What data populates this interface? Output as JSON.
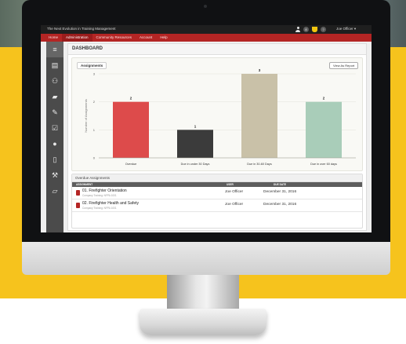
{
  "app": {
    "title": "The Next Evolution in Training Management",
    "user_menu": "Joe Officer ▾",
    "badge_1": "8",
    "badge_2": "?"
  },
  "nav": [
    "Home",
    "Administration",
    "Community Resources",
    "Account",
    "Help"
  ],
  "sidebar": [
    {
      "icon": "dashboard-icon",
      "glyph": "≡"
    },
    {
      "icon": "database-icon",
      "glyph": "▤"
    },
    {
      "icon": "users-icon",
      "glyph": "⚇"
    },
    {
      "icon": "book-icon",
      "glyph": "▰"
    },
    {
      "icon": "edit-icon",
      "glyph": "✎"
    },
    {
      "icon": "checkbox-icon",
      "glyph": "☑"
    },
    {
      "icon": "circle-icon",
      "glyph": "●"
    },
    {
      "icon": "document-icon",
      "glyph": "▯"
    },
    {
      "icon": "wrench-icon",
      "glyph": "⚒"
    },
    {
      "icon": "folder-icon",
      "glyph": "▱"
    }
  ],
  "page": {
    "title": "DASHBOARD"
  },
  "assignments": {
    "label": "Assignments",
    "report_button": "View As Report"
  },
  "chart_data": {
    "type": "bar",
    "categories": [
      "Overdue",
      "Due in under 30 Days",
      "Due in 30-60 Days",
      "Due in over 60 days"
    ],
    "values": [
      2,
      1,
      3,
      2
    ],
    "ylabel": "Number of Assignments",
    "ylim": [
      0,
      3
    ],
    "yticks": [
      0,
      1,
      2,
      3
    ],
    "colors": [
      "#dd4b4b",
      "#3b3b3b",
      "#c9c1a8",
      "#a9cdb9"
    ],
    "grid": true
  },
  "overdue": {
    "title": "Overdue Assignments",
    "columns": {
      "assignment": "ASSIGNMENT",
      "user": "USER",
      "due": "DUE DATE"
    },
    "rows": [
      {
        "name": "01. Firefighter Orientation",
        "sub": "Company Training: NFPA 1001",
        "user": "Joe Officer",
        "due": "December 31, 2016"
      },
      {
        "name": "02. Firefighter Health and Safety",
        "sub": "Company Training: NFPA 1001",
        "user": "Joe Officer",
        "due": "December 31, 2016"
      }
    ]
  }
}
